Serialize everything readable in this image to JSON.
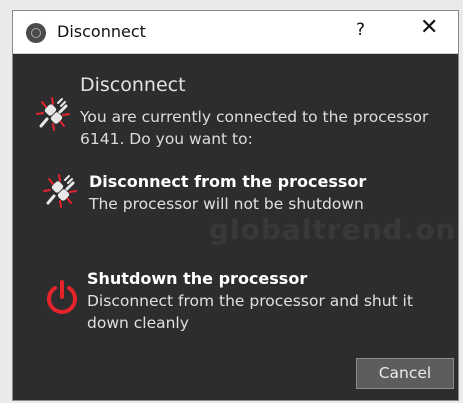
{
  "window": {
    "title": "Disconnect",
    "help_label": "?",
    "close_label": "✕"
  },
  "content": {
    "heading": "Disconnect",
    "description": "You are currently connected to the processor 6141. Do you want to:"
  },
  "options": [
    {
      "title": "Disconnect from the processor",
      "description": "The processor will not be shutdown",
      "icon": "unplug-icon"
    },
    {
      "title": "Shutdown the processor",
      "description": "Disconnect from the processor and shut it down cleanly",
      "icon": "power-icon"
    }
  ],
  "buttons": {
    "cancel_label": "Cancel"
  },
  "watermark": "globaltrend.one",
  "colors": {
    "dialog_background": "#2d2d2f",
    "accent_red": "#e5232b",
    "button_background": "#5d5d5f"
  }
}
